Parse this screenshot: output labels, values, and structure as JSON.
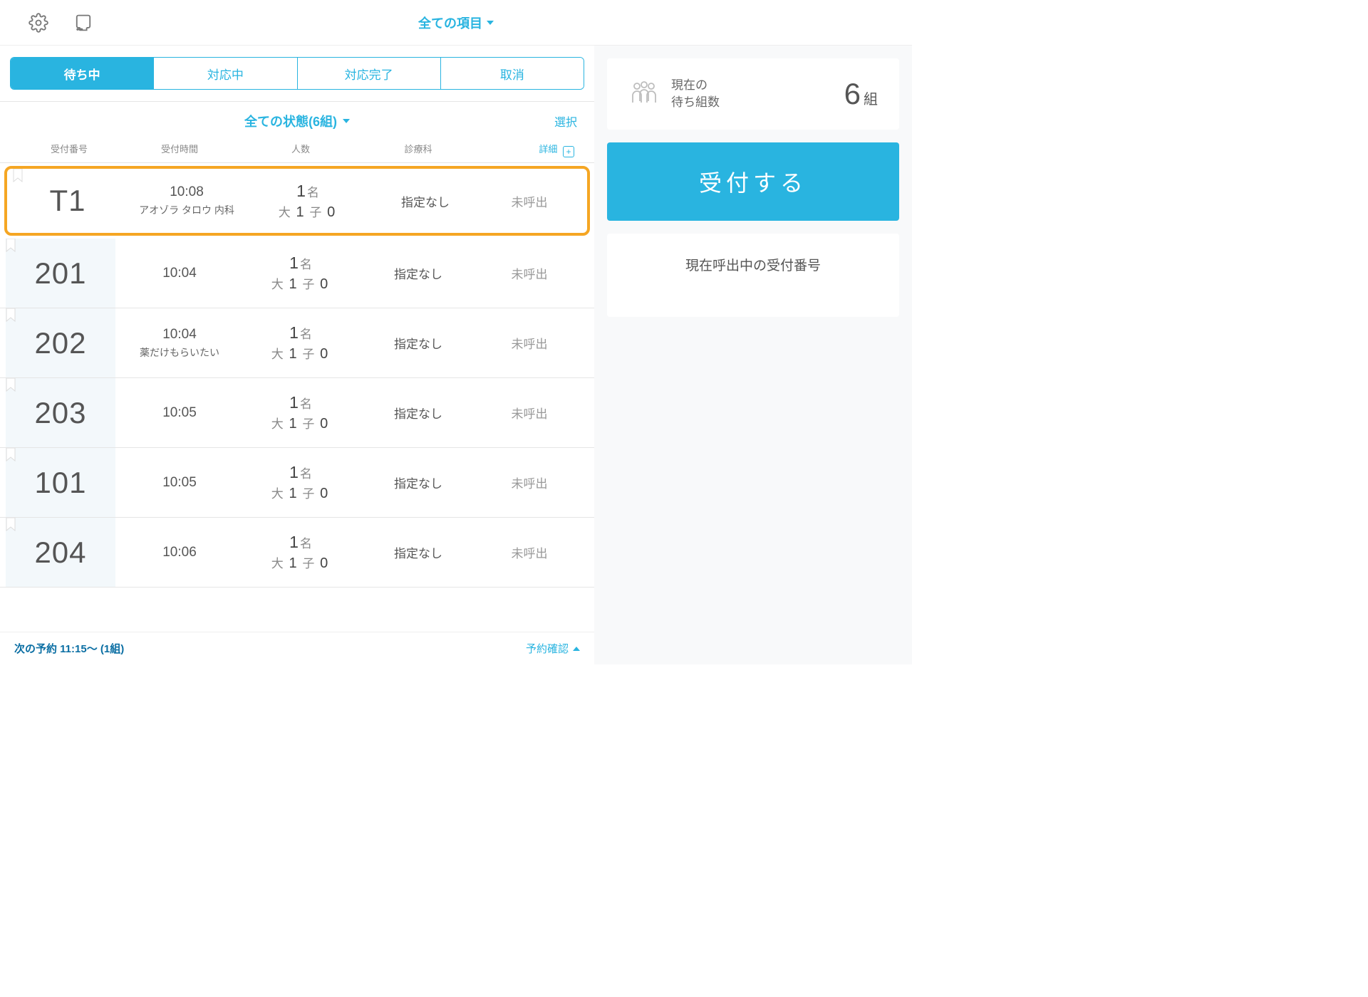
{
  "header": {
    "title": "全ての項目"
  },
  "tabs": [
    {
      "label": "待ち中",
      "active": true
    },
    {
      "label": "対応中",
      "active": false
    },
    {
      "label": "対応完了",
      "active": false
    },
    {
      "label": "取消",
      "active": false
    }
  ],
  "filter": {
    "title": "全ての状態(6組)",
    "select_label": "選択"
  },
  "columns": {
    "num": "受付番号",
    "time": "受付時間",
    "people": "人数",
    "dept": "診療科",
    "detail": "詳細"
  },
  "rows": [
    {
      "num": "T1",
      "time": "10:08",
      "sub": "アオゾラ タロウ 内科",
      "count": "1",
      "count_suffix": "名",
      "breakdown": "大 1 子 0",
      "dept": "指定なし",
      "status": "未呼出",
      "highlight": true
    },
    {
      "num": "201",
      "time": "10:04",
      "sub": "",
      "count": "1",
      "count_suffix": "名",
      "breakdown": "大 1 子 0",
      "dept": "指定なし",
      "status": "未呼出",
      "highlight": false
    },
    {
      "num": "202",
      "time": "10:04",
      "sub": "薬だけもらいたい",
      "count": "1",
      "count_suffix": "名",
      "breakdown": "大 1 子 0",
      "dept": "指定なし",
      "status": "未呼出",
      "highlight": false
    },
    {
      "num": "203",
      "time": "10:05",
      "sub": "",
      "count": "1",
      "count_suffix": "名",
      "breakdown": "大 1 子 0",
      "dept": "指定なし",
      "status": "未呼出",
      "highlight": false
    },
    {
      "num": "101",
      "time": "10:05",
      "sub": "",
      "count": "1",
      "count_suffix": "名",
      "breakdown": "大 1 子 0",
      "dept": "指定なし",
      "status": "未呼出",
      "highlight": false
    },
    {
      "num": "204",
      "time": "10:06",
      "sub": "",
      "count": "1",
      "count_suffix": "名",
      "breakdown": "大 1 子 0",
      "dept": "指定なし",
      "status": "未呼出",
      "highlight": false
    }
  ],
  "footer": {
    "next_reservation": "次の予約 11:15～ (1組)",
    "confirm": "予約確認"
  },
  "side": {
    "waiting_label_line1": "現在の",
    "waiting_label_line2": "待ち組数",
    "waiting_count": "6",
    "waiting_unit": "組",
    "accept_button": "受付する",
    "calling_title": "現在呼出中の受付番号"
  }
}
